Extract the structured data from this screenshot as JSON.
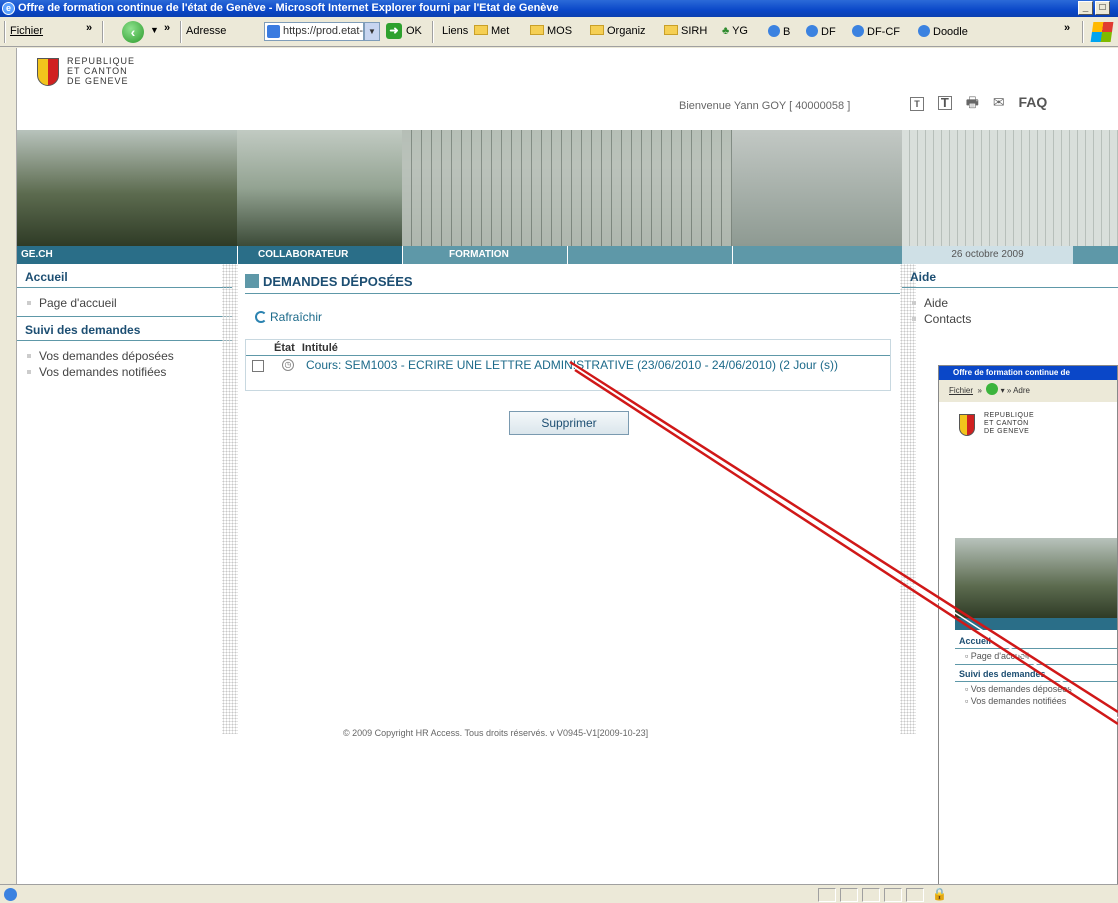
{
  "window": {
    "title": "Offre de formation continue de l'état de Genève - Microsoft Internet Explorer fourni par l'Etat de Genève"
  },
  "toolbar": {
    "fichier": "Fichier",
    "chev1": "»",
    "chev2": "»",
    "adresse": "Adresse",
    "url": "https://prod.etat-ge.ch/",
    "ok": "OK",
    "liens": "Liens",
    "links": [
      "Met",
      "MOS",
      "Organiz",
      "SIRH",
      "YG",
      "B",
      "DF",
      "DF-CF",
      "Doodle"
    ],
    "chev3": "»"
  },
  "header": {
    "crest_text": [
      "REPUBLIQUE",
      "ET CANTON",
      "DE GENEVE"
    ],
    "welcome": "Bienvenue Yann GOY [ 40000058 ]",
    "faq": "FAQ"
  },
  "nav": {
    "ge": "GE.CH",
    "collab": "COLLABORATEUR",
    "formation": "FORMATION",
    "date": "26 octobre 2009"
  },
  "left": {
    "accueil": "Accueil",
    "page_accueil": "Page d'accueil",
    "suivi": "Suivi des demandes",
    "deposees": "Vos demandes déposées",
    "notifiees": "Vos demandes notifiées"
  },
  "main": {
    "title": "DEMANDES DÉPOSÉES",
    "refresh": "Rafraîchir",
    "col_etat": "État",
    "col_intitule": "Intitulé",
    "row_text": "Cours: SEM1003 - ECRIRE UNE LETTRE ADMINISTRATIVE (23/06/2010 - 24/06/2010) (2 Jour (s))",
    "delete": "Supprimer",
    "copyright": "© 2009 Copyright HR Access. Tous droits réservés. v V0945-V1[2009-10-23]"
  },
  "right": {
    "aide_title": "Aide",
    "aide": "Aide",
    "contacts": "Contacts"
  },
  "inset": {
    "title": "Offre de formation continue de",
    "fichier": "Fichier",
    "adre": "Adre",
    "crest_text": [
      "REPUBLIQUE",
      "ET CANTON",
      "DE GENEVE"
    ],
    "accueil": "Accueil",
    "page_accueil": "Page d'accueil",
    "suivi": "Suivi des demandes",
    "deposees": "Vos demandes déposées",
    "notifiees": "Vos demandes notifiées"
  },
  "colors": {
    "teal": "#5e98a8",
    "dark_blue": "#1c4e72",
    "link": "#1c6a8a",
    "red_line": "#d01818"
  }
}
